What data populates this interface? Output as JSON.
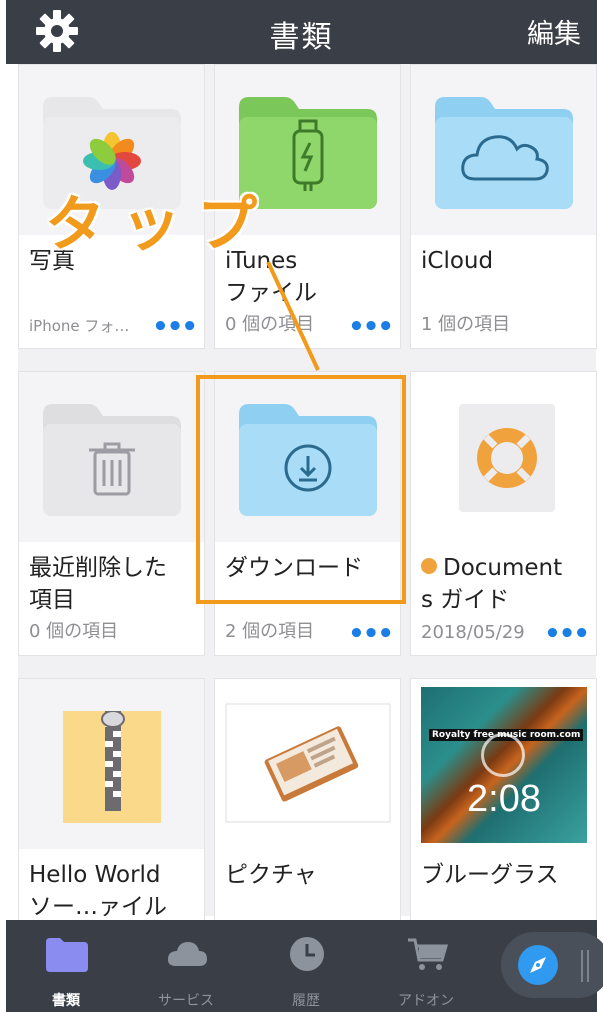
{
  "header": {
    "title": "書類",
    "edit_label": "編集",
    "settings_icon": "gear-icon"
  },
  "annotation": {
    "tap_label": "タップ",
    "color": "#f19a1b"
  },
  "grid": {
    "items": [
      {
        "name": "写真",
        "meta": "iPhone フォ…",
        "icon": "photos-folder-icon",
        "more": "•••"
      },
      {
        "name": "iTunes\nファイル",
        "meta": "0 個の項目",
        "icon": "usb-folder-icon",
        "more": "•••"
      },
      {
        "name": "iCloud",
        "meta": "1 個の項目",
        "icon": "cloud-folder-icon"
      },
      {
        "name": "最近削除した\n項目",
        "meta": "0 個の項目",
        "icon": "trash-folder-icon"
      },
      {
        "name": "ダウンロード",
        "meta": "2 個の項目",
        "icon": "download-folder-icon",
        "more": "•••"
      },
      {
        "name": "Document\ns ガイド",
        "meta": "2018/05/29",
        "icon": "lifebuoy-icon",
        "more": "•••"
      },
      {
        "name": "Hello World\nソー…ァイル",
        "icon": "zip-file-icon"
      },
      {
        "name": "ピクチャ",
        "icon": "picture-thumbnail"
      },
      {
        "name": "ブルーグラス",
        "icon": "video-thumbnail",
        "video_duration": "2:08",
        "video_caption": "Royalty free music room.com"
      }
    ]
  },
  "tabbar": {
    "tabs": [
      {
        "label": "書類",
        "icon": "folder-icon",
        "active": true
      },
      {
        "label": "サービス",
        "icon": "cloud-icon"
      },
      {
        "label": "履歴",
        "icon": "clock-icon"
      },
      {
        "label": "アドオン",
        "icon": "cart-icon"
      }
    ],
    "browser_icon": "compass-icon"
  },
  "colors": {
    "bar": "#3a3f47",
    "accent": "#1a7ee6",
    "folder_blue": "#a9dcf7",
    "folder_green": "#8fd66b",
    "folder_grey": "#e7e7ea",
    "annotation": "#f19a1b"
  }
}
